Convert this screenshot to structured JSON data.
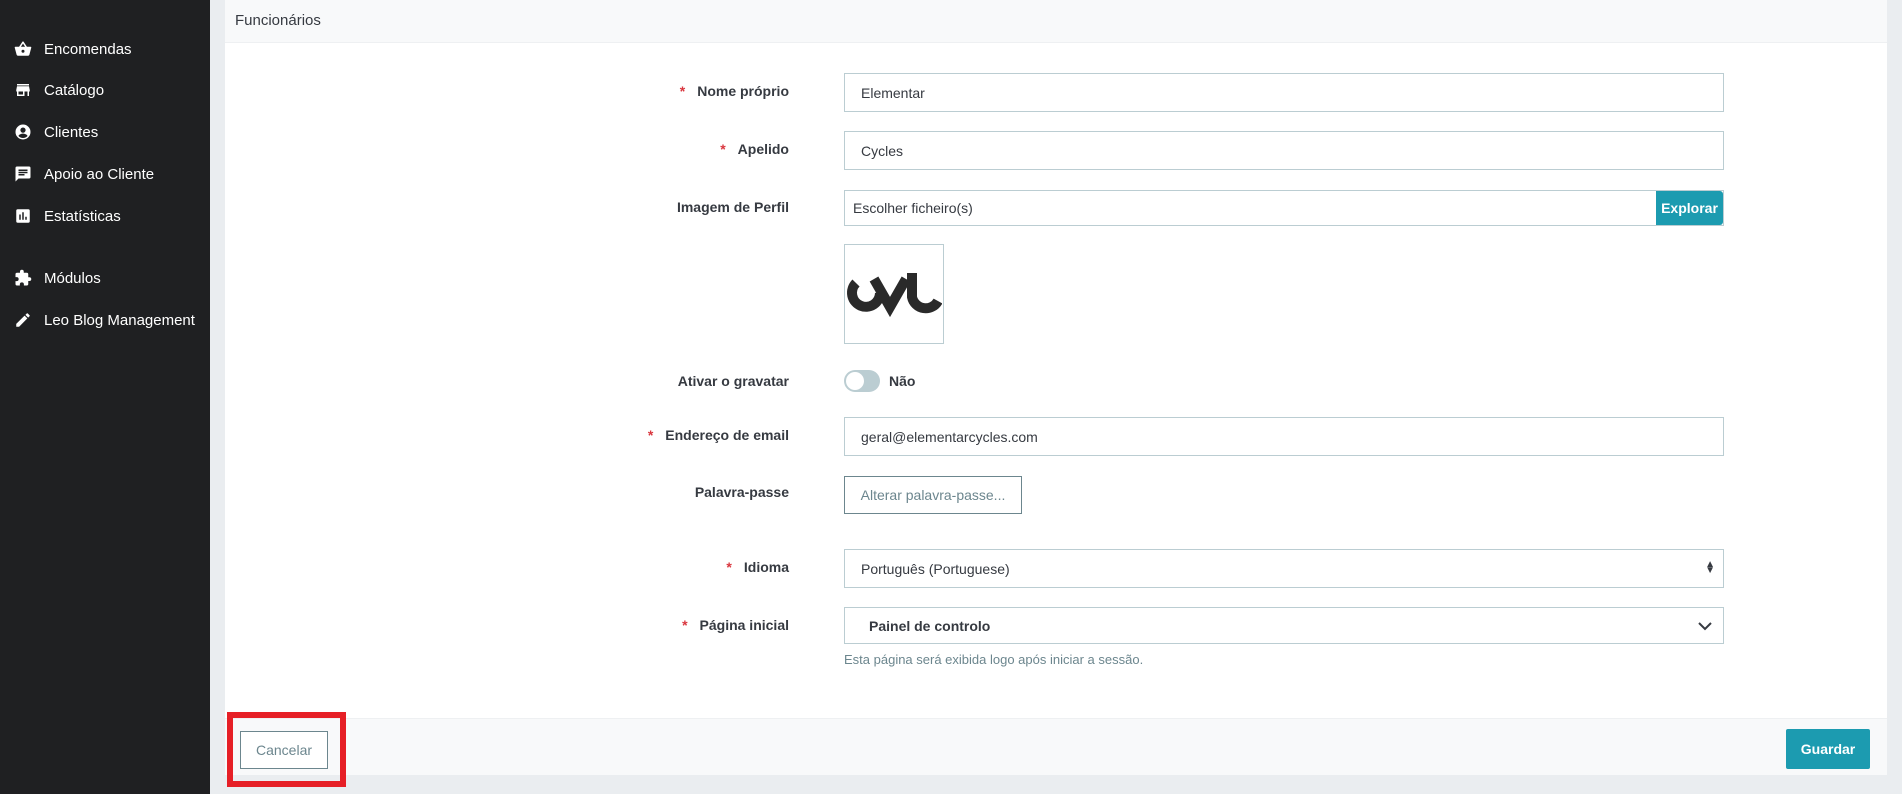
{
  "sidebar": {
    "items": [
      {
        "label": "Encomendas",
        "icon": "basket-icon"
      },
      {
        "label": "Catálogo",
        "icon": "store-icon"
      },
      {
        "label": "Clientes",
        "icon": "account-circle-icon"
      },
      {
        "label": "Apoio ao Cliente",
        "icon": "chat-icon"
      },
      {
        "label": "Estatísticas",
        "icon": "bar-chart-icon"
      },
      {
        "label": "Módulos",
        "icon": "puzzle-icon"
      },
      {
        "label": "Leo Blog Management",
        "icon": "pencil-icon"
      }
    ]
  },
  "card": {
    "title": "Funcionários"
  },
  "form": {
    "first_name": {
      "label": "Nome próprio",
      "value": "Elementar",
      "required": "*"
    },
    "last_name": {
      "label": "Apelido",
      "value": "Cycles",
      "required": "*"
    },
    "profile_image": {
      "label": "Imagem de Perfil",
      "file_text": "Escolher ficheiro(s)",
      "browse_label": "Explorar"
    },
    "gravatar": {
      "label": "Ativar o gravatar",
      "state_label": "Não"
    },
    "email": {
      "label": "Endereço de email",
      "value": "geral@elementarcycles.com",
      "required": "*"
    },
    "password": {
      "label": "Palavra-passe",
      "button_label": "Alterar palavra-passe..."
    },
    "language": {
      "label": "Idioma",
      "value": "Português (Portuguese)",
      "required": "*"
    },
    "homepage": {
      "label": "Página inicial",
      "value": "Painel de controlo",
      "required": "*",
      "help": "Esta página será exibida logo após iniciar a sessão."
    }
  },
  "footer": {
    "cancel_label": "Cancelar",
    "save_label": "Guardar"
  },
  "colors": {
    "sidebar_bg": "#1f2022",
    "accent": "#1c9bb0",
    "required": "#d9363e",
    "highlight": "#e61f26"
  }
}
